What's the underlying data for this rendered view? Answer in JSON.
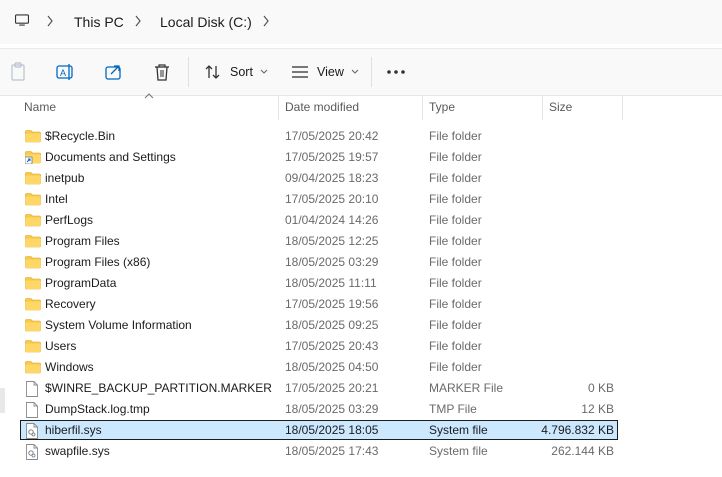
{
  "breadcrumb": {
    "items": [
      "This PC",
      "Local Disk (C:)"
    ]
  },
  "toolbar": {
    "sort_label": "Sort",
    "view_label": "View"
  },
  "columns": {
    "name": "Name",
    "date": "Date modified",
    "type": "Type",
    "size": "Size"
  },
  "files": [
    {
      "name": "$Recycle.Bin",
      "date": "17/05/2025 20:42",
      "type": "File folder",
      "size": "",
      "icon": "folder-icon"
    },
    {
      "name": "Documents and Settings",
      "date": "17/05/2025 19:57",
      "type": "File folder",
      "size": "",
      "icon": "folder-shortcut-icon"
    },
    {
      "name": "inetpub",
      "date": "09/04/2025 18:23",
      "type": "File folder",
      "size": "",
      "icon": "folder-icon"
    },
    {
      "name": "Intel",
      "date": "17/05/2025 20:10",
      "type": "File folder",
      "size": "",
      "icon": "folder-icon"
    },
    {
      "name": "PerfLogs",
      "date": "01/04/2024 14:26",
      "type": "File folder",
      "size": "",
      "icon": "folder-icon"
    },
    {
      "name": "Program Files",
      "date": "18/05/2025 12:25",
      "type": "File folder",
      "size": "",
      "icon": "folder-icon"
    },
    {
      "name": "Program Files (x86)",
      "date": "18/05/2025 03:29",
      "type": "File folder",
      "size": "",
      "icon": "folder-icon"
    },
    {
      "name": "ProgramData",
      "date": "18/05/2025 11:11",
      "type": "File folder",
      "size": "",
      "icon": "folder-icon"
    },
    {
      "name": "Recovery",
      "date": "17/05/2025 19:56",
      "type": "File folder",
      "size": "",
      "icon": "folder-icon"
    },
    {
      "name": "System Volume Information",
      "date": "18/05/2025 09:25",
      "type": "File folder",
      "size": "",
      "icon": "folder-icon"
    },
    {
      "name": "Users",
      "date": "17/05/2025 20:43",
      "type": "File folder",
      "size": "",
      "icon": "folder-icon"
    },
    {
      "name": "Windows",
      "date": "18/05/2025 04:50",
      "type": "File folder",
      "size": "",
      "icon": "folder-icon"
    },
    {
      "name": "$WINRE_BACKUP_PARTITION.MARKER",
      "date": "17/05/2025 20:21",
      "type": "MARKER File",
      "size": "0 KB",
      "icon": "file-icon"
    },
    {
      "name": "DumpStack.log.tmp",
      "date": "18/05/2025 03:29",
      "type": "TMP File",
      "size": "12 KB",
      "icon": "file-icon"
    },
    {
      "name": "hiberfil.sys",
      "date": "18/05/2025 18:05",
      "type": "System file",
      "size": "4.796.832 KB",
      "icon": "system-file-icon",
      "selected": true
    },
    {
      "name": "swapfile.sys",
      "date": "18/05/2025 17:43",
      "type": "System file",
      "size": "262.144 KB",
      "icon": "system-file-icon"
    }
  ],
  "colors": {
    "folder": "#f7c948",
    "accent": "#0067c0",
    "selection": "#cce8ff"
  }
}
